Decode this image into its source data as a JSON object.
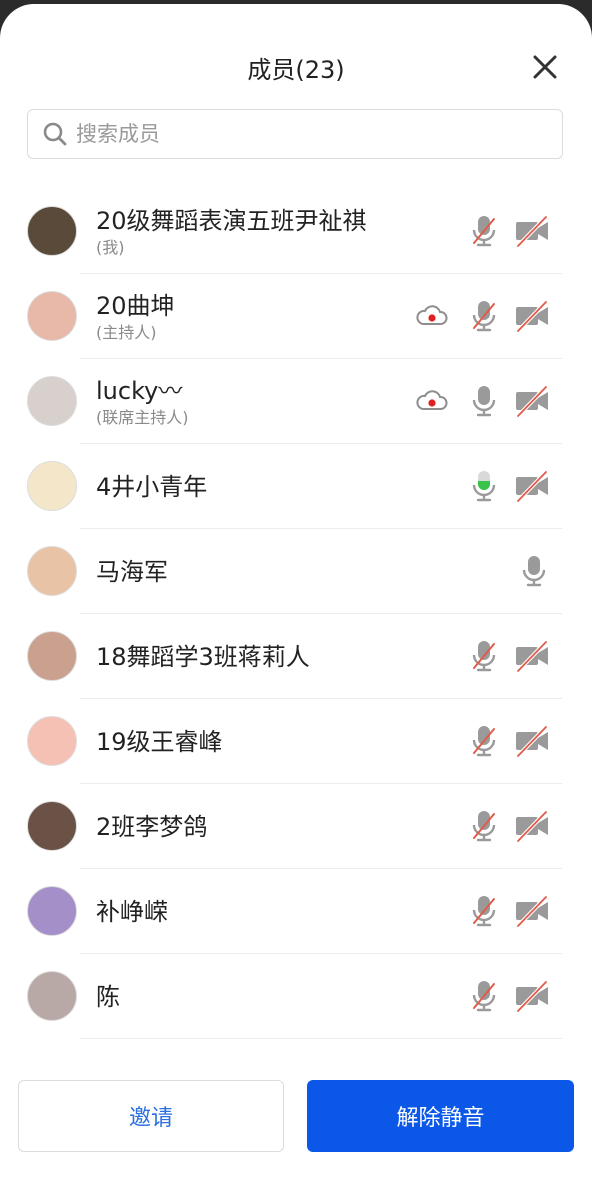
{
  "header": {
    "title": "成员(23)"
  },
  "search": {
    "placeholder": "搜索成员"
  },
  "members": [
    {
      "name": "20级舞蹈表演五班尹祉祺",
      "sub": "(我)",
      "mic": "muted",
      "camera": "off",
      "cloud": false,
      "avatar_color": "#5a4a3a"
    },
    {
      "name": "20曲坤",
      "sub": "(主持人)",
      "mic": "muted",
      "camera": "off",
      "cloud": true,
      "avatar_color": "#e8b9a8"
    },
    {
      "name": "lucky〰",
      "sub": "(联席主持人)",
      "mic": "on",
      "camera": "off",
      "cloud": true,
      "avatar_color": "#d8d0cc"
    },
    {
      "name": "4井小青年",
      "sub": "",
      "mic": "speaking",
      "camera": "off",
      "cloud": false,
      "avatar_color": "#f4e6c8"
    },
    {
      "name": "马海军",
      "sub": "",
      "mic": "on",
      "camera": "none",
      "cloud": false,
      "avatar_color": "#e9c3a6"
    },
    {
      "name": "18舞蹈学3班蒋莉人",
      "sub": "",
      "mic": "muted",
      "camera": "off",
      "cloud": false,
      "avatar_color": "#caa08e"
    },
    {
      "name": "19级王睿峰",
      "sub": "",
      "mic": "muted",
      "camera": "off",
      "cloud": false,
      "avatar_color": "#f6c1b5"
    },
    {
      "name": "2班李梦鸽",
      "sub": "",
      "mic": "muted",
      "camera": "off",
      "cloud": false,
      "avatar_color": "#6b5246"
    },
    {
      "name": "补峥嵘",
      "sub": "",
      "mic": "muted",
      "camera": "off",
      "cloud": false,
      "avatar_color": "#a48fc8"
    },
    {
      "name": "陈",
      "sub": "",
      "mic": "muted",
      "camera": "off",
      "cloud": false,
      "avatar_color": "#b8a8a6"
    }
  ],
  "footer": {
    "invite_label": "邀请",
    "unmute_label": "解除静音"
  },
  "colors": {
    "accent": "#0a57e8",
    "speaking": "#39c34a",
    "muted_slash": "#e25b4a",
    "record_dot": "#e02020"
  }
}
